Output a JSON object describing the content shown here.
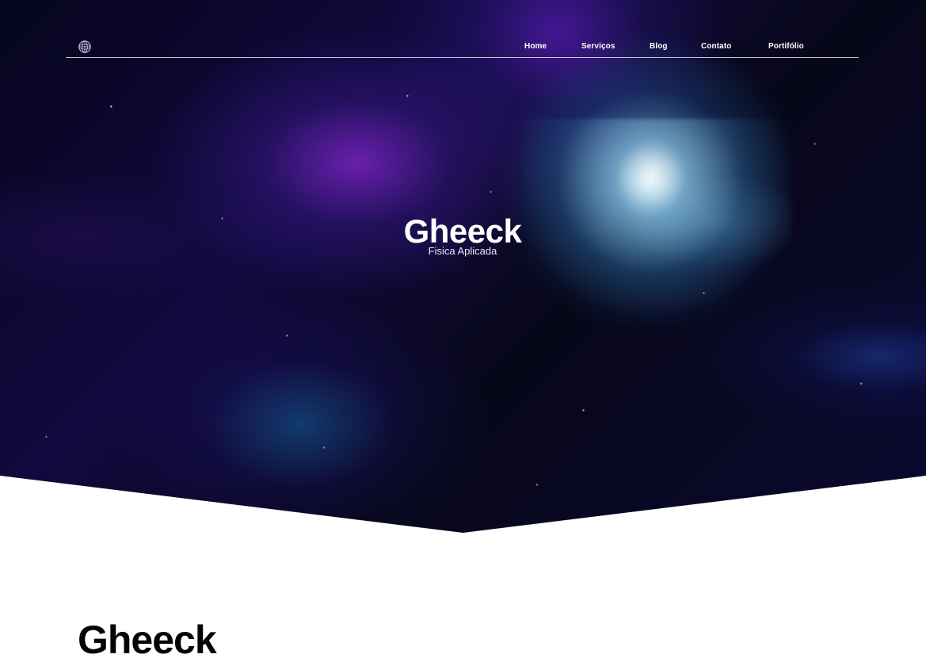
{
  "header": {
    "logo_icon": "globe-icon",
    "nav": [
      {
        "label": "Home"
      },
      {
        "label": "Serviços"
      },
      {
        "label": "Blog"
      },
      {
        "label": "Contato"
      },
      {
        "label": "Portifólio"
      }
    ]
  },
  "hero": {
    "title": "Gheeck",
    "subtitle": "Fisica Aplicada"
  },
  "content": {
    "title": "Gheeck"
  }
}
